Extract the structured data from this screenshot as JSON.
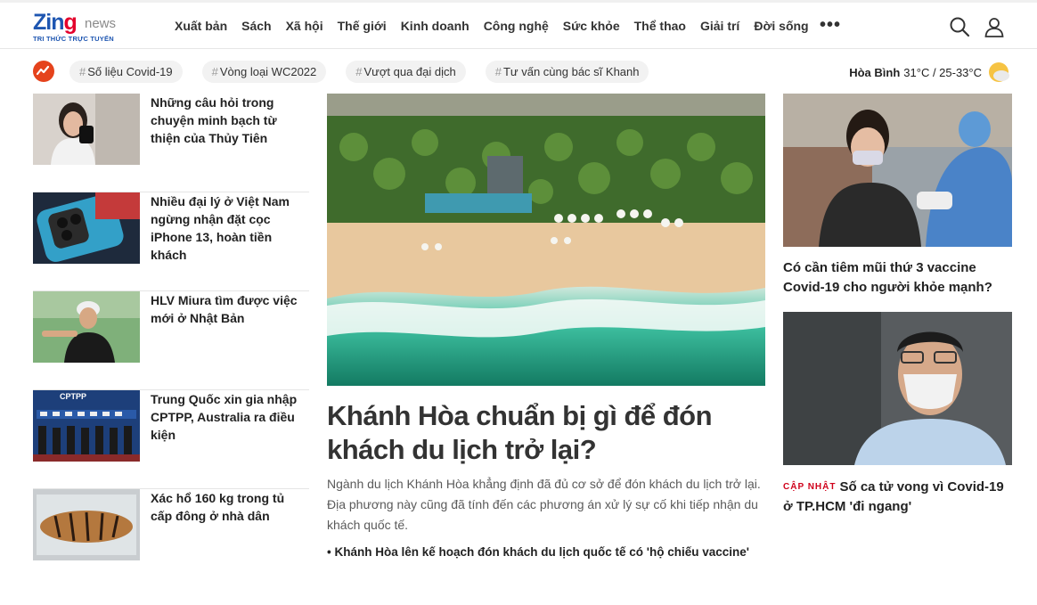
{
  "brand": {
    "logo_main": "Zin",
    "logo_g": "g",
    "logo_news": "news",
    "tagline": "TRI THỨC TRỰC TUYẾN"
  },
  "nav": [
    "Xuất bản",
    "Sách",
    "Xã hội",
    "Thế giới",
    "Kinh doanh",
    "Công nghệ",
    "Sức khỏe",
    "Thể thao",
    "Giải trí",
    "Đời sống"
  ],
  "nav_more": "•••",
  "header_icons": [
    "search-icon",
    "user-icon"
  ],
  "trending": {
    "icon": "trending-icon",
    "tags": [
      "Số liệu Covid-19",
      "Vòng loại WC2022",
      "Vượt qua đại dịch",
      "Tư vấn cùng bác sĩ Khanh"
    ],
    "hash": "#"
  },
  "weather": {
    "location": "Hòa Bình",
    "temp": "31°C / 25-33°C",
    "icon": "sun-cloud-icon"
  },
  "left_stories": [
    {
      "title": "Những câu hỏi trong chuyện minh bạch từ thiện của Thủy Tiên"
    },
    {
      "title": "Nhiều đại lý ở Việt Nam ngừng nhận đặt cọc iPhone 13, hoàn tiền khách"
    },
    {
      "title": "HLV Miura tìm được việc mới ở Nhật Bản"
    },
    {
      "title": "Trung Quốc xin gia nhập CPTPP, Australia ra điều kiện"
    },
    {
      "title": "Xác hổ 160 kg trong tủ cấp đông ở nhà dân"
    }
  ],
  "main_story": {
    "title": "Khánh Hòa chuẩn bị gì để đón khách du lịch trở lại?",
    "summary": "Ngành du lịch Khánh Hòa khẳng định đã đủ cơ sở để đón khách du lịch trở lại. Địa phương này cũng đã tính đến các phương án xử lý sự cố khi tiếp nhận du khách quốc tế.",
    "related": "• Khánh Hòa lên kế hoạch đón khách du lịch quốc tế có 'hộ chiếu vaccine'"
  },
  "right_stories": [
    {
      "title": "Có cần tiêm mũi thứ 3 vaccine Covid-19 cho người khỏe mạnh?"
    },
    {
      "badge": "CẬP NHẬT",
      "title": "Số ca tử vong vì Covid-19 ở TP.HCM 'đi ngang'"
    }
  ],
  "colors": {
    "brand_blue": "#1e56b1",
    "brand_red": "#e4002b",
    "update_red": "#d0021b",
    "trend_orange": "#e5431c"
  }
}
